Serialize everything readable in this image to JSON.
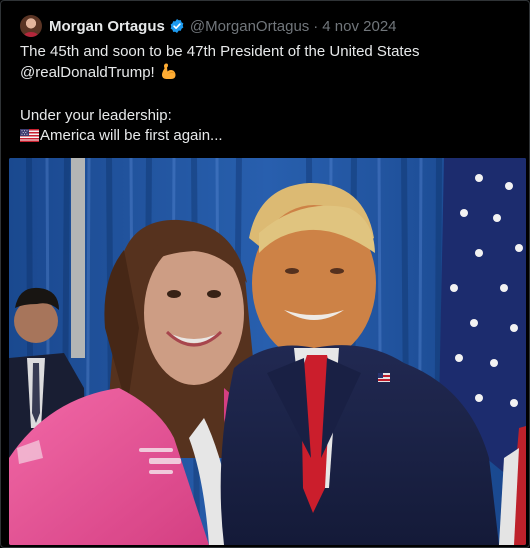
{
  "tweet": {
    "author": {
      "name": "Morgan Ortagus",
      "handle": "@MorganOrtagus",
      "verified": true
    },
    "separator": "·",
    "date": "4 nov 2024",
    "text": {
      "line1": "The 45th and soon to be 47th President of the United States",
      "line2": "@realDonaldTrump!",
      "line3": "Under your leadership:",
      "line4": "America will be first again..."
    },
    "emojis": {
      "line2_end": "flexed-biceps-emoji",
      "line4_start": "us-flag-emoji"
    },
    "colors": {
      "verified_badge": "#1d9bf0",
      "text": "#e7e9ea",
      "muted": "#71767b",
      "background": "#000000"
    }
  }
}
